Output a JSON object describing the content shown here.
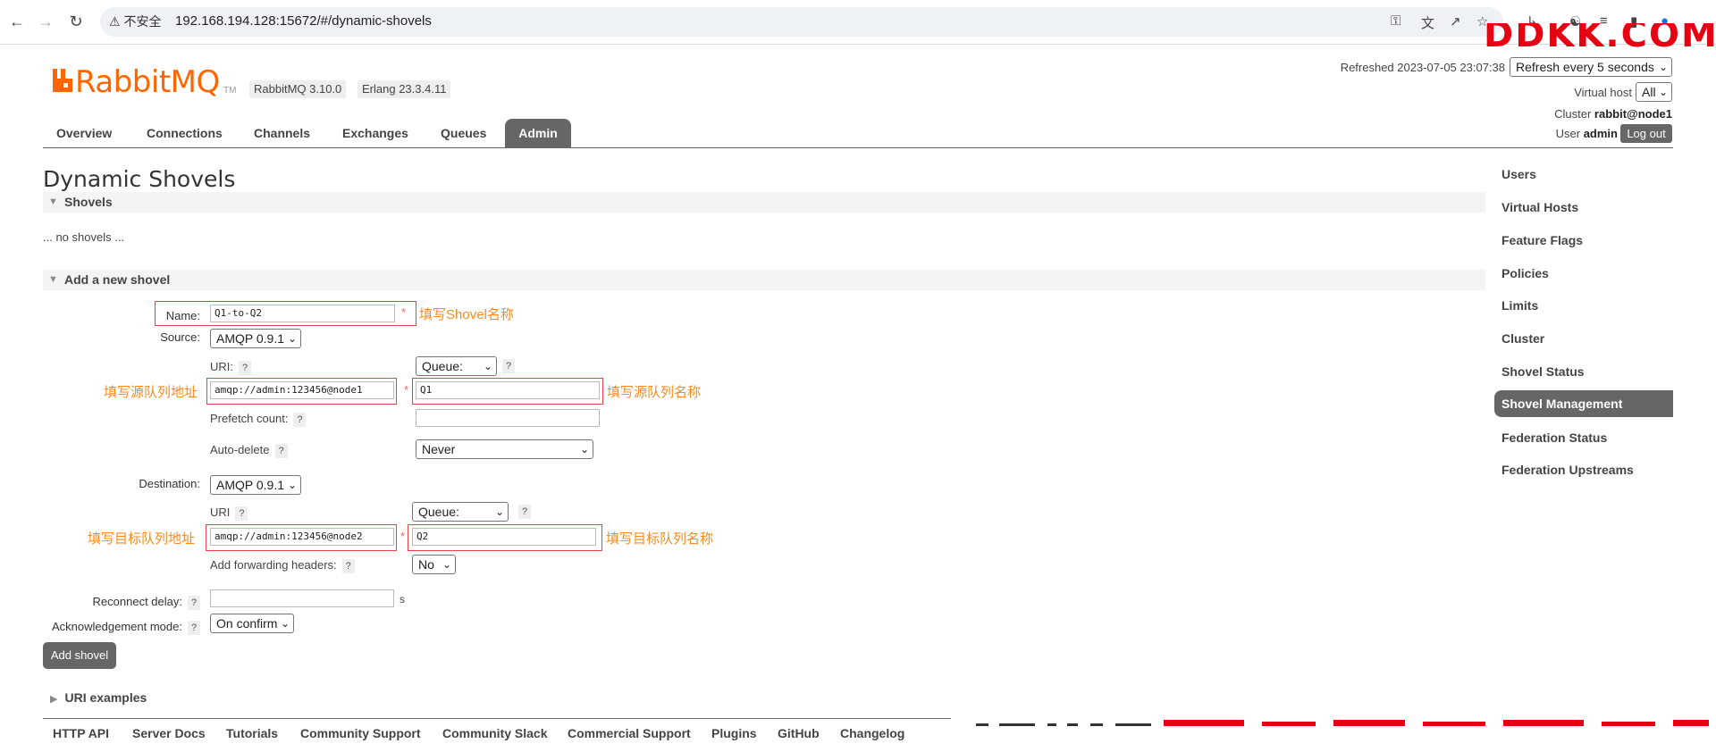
{
  "browser": {
    "security_label": "不安全",
    "url": "192.168.194.128:15672/#/dynamic-shovels"
  },
  "header": {
    "brand": "RabbitMQ",
    "tm": "TM",
    "version": "RabbitMQ 3.10.0",
    "erlang": "Erlang 23.3.4.11",
    "refreshed_label": "Refreshed 2023-07-05 23:07:38",
    "refresh_select": "Refresh every 5 seconds",
    "vhost_label": "Virtual host",
    "vhost_select": "All",
    "cluster_label": "Cluster",
    "cluster_value": "rabbit@node1",
    "user_label": "User",
    "user_value": "admin",
    "logout_label": "Log out"
  },
  "tabs": [
    "Overview",
    "Connections",
    "Channels",
    "Exchanges",
    "Queues",
    "Admin"
  ],
  "page_title": "Dynamic Shovels",
  "shovels_section": {
    "label": "Shovels",
    "empty_text": "... no shovels ..."
  },
  "add_section": {
    "label": "Add a new shovel"
  },
  "form": {
    "name_label": "Name:",
    "name_value": "Q1-to-Q2",
    "source_label": "Source:",
    "source_protocol": "AMQP 0.9.1",
    "uri_label": "URI:",
    "source_uri": "amqp://admin:123456@node1",
    "source_type": "Queue:",
    "source_queue": "Q1",
    "prefetch_label": "Prefetch count:",
    "autodelete_label": "Auto-delete",
    "autodelete_value": "Never",
    "dest_label": "Destination:",
    "dest_protocol": "AMQP 0.9.1",
    "dest_uri_label": "URI",
    "dest_uri": "amqp://admin:123456@node2",
    "dest_type": "Queue:",
    "dest_queue": "Q2",
    "fwd_headers_label": "Add forwarding headers:",
    "fwd_headers_value": "No",
    "reconnect_label": "Reconnect delay:",
    "reconnect_unit": "s",
    "ack_label": "Acknowledgement mode:",
    "ack_value": "On confirm",
    "help_glyph": "?",
    "required_mark": "*",
    "submit_label": "Add shovel"
  },
  "annotations": {
    "name": "填写Shovel名称",
    "src_uri": "填写源队列地址",
    "src_queue": "填写源队列名称",
    "dst_uri": "填写目标队列地址",
    "dst_queue": "填写目标队列名称"
  },
  "uri_examples_label": "URI examples",
  "sidebar": {
    "items": [
      "Users",
      "Virtual Hosts",
      "Feature Flags",
      "Policies",
      "Limits",
      "Cluster",
      "Shovel Status",
      "Shovel Management",
      "Federation Status",
      "Federation Upstreams"
    ],
    "active": "Shovel Management"
  },
  "footer": [
    "HTTP API",
    "Server Docs",
    "Tutorials",
    "Community Support",
    "Community Slack",
    "Commercial Support",
    "Plugins",
    "GitHub",
    "Changelog"
  ],
  "colors": {
    "brand": "#ff6600",
    "annotation": "#f68b1f",
    "annotation_box": "#e64545",
    "active_tab": "#666666"
  }
}
